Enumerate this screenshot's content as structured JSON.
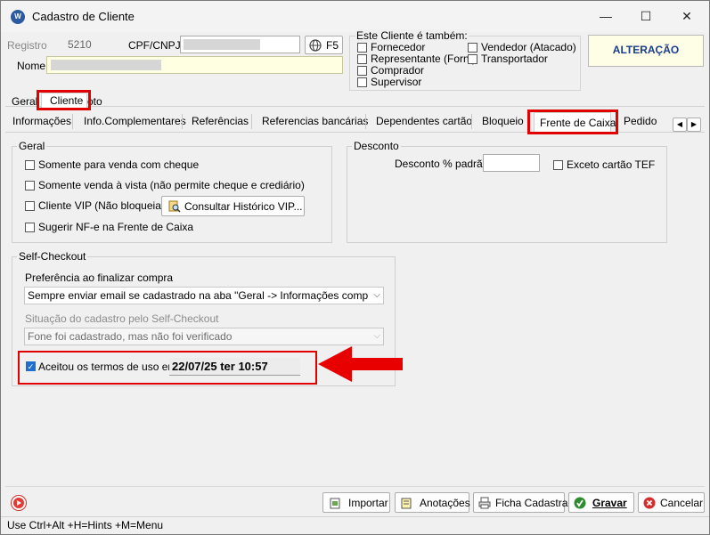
{
  "window": {
    "title": "Cadastro de Cliente",
    "icon": "app-logo-icon",
    "min": "—",
    "max": "☐",
    "close": "✕"
  },
  "header": {
    "registro_label": "Registro",
    "registro_value": "5210",
    "cpf_label": "CPF/CNPJ",
    "f5_label": "F5",
    "nome_label": "Nome",
    "also_title": "Este Cliente é também:",
    "roles": [
      "Fornecedor",
      "Representante (Forn.)",
      "Comprador",
      "Supervisor",
      "Vendedor (Atacado)",
      "Transportador"
    ],
    "mode": "ALTERAÇÃO"
  },
  "main_tabs": [
    "Geral",
    "Cliente",
    "oto"
  ],
  "sub_tabs": [
    "Informações",
    "Info.Complementares",
    "Referências",
    "Referencias bancárias",
    "Dependentes cartão",
    "Bloqueio",
    "Frente de Caixa",
    "Pedido"
  ],
  "geral_group": {
    "title": "Geral",
    "opt1": "Somente para venda com cheque",
    "opt2": "Somente venda à vista (não permite cheque e crediário)",
    "opt3": "Cliente VIP (Não bloqueia)",
    "vip_button": "Consultar Histórico VIP...",
    "opt4": "Sugerir NF-e na Frente de Caixa"
  },
  "desconto_group": {
    "title": "Desconto",
    "label": "Desconto % padrão",
    "exceto": "Exceto cartão TEF"
  },
  "self_checkout": {
    "title": "Self-Checkout",
    "pref_label": "Preferência ao finalizar compra",
    "pref_value": "Sempre enviar email se cadastrado na aba \"Geral -> Informações complementares\"",
    "situacao_label": "Situação do cadastro pelo Self-Checkout",
    "situacao_value": "Fone foi cadastrado, mas não foi verificado",
    "aceitou_label": "Aceitou os termos de uso em",
    "aceitou_value": "22/07/25 ter 10:57"
  },
  "footer": {
    "importar": "Importar",
    "anotacoes": "Anotações",
    "ficha": "Ficha Cadastral",
    "gravar": "Gravar",
    "cancelar": "Cancelar",
    "status": "Use Ctrl+Alt +H=Hints +M=Menu"
  },
  "colors": {
    "highlight": "#e00000",
    "mode_bg": "#fefee6",
    "nome_bg": "#ffffe1",
    "mode_text": "#1a3c8c"
  }
}
